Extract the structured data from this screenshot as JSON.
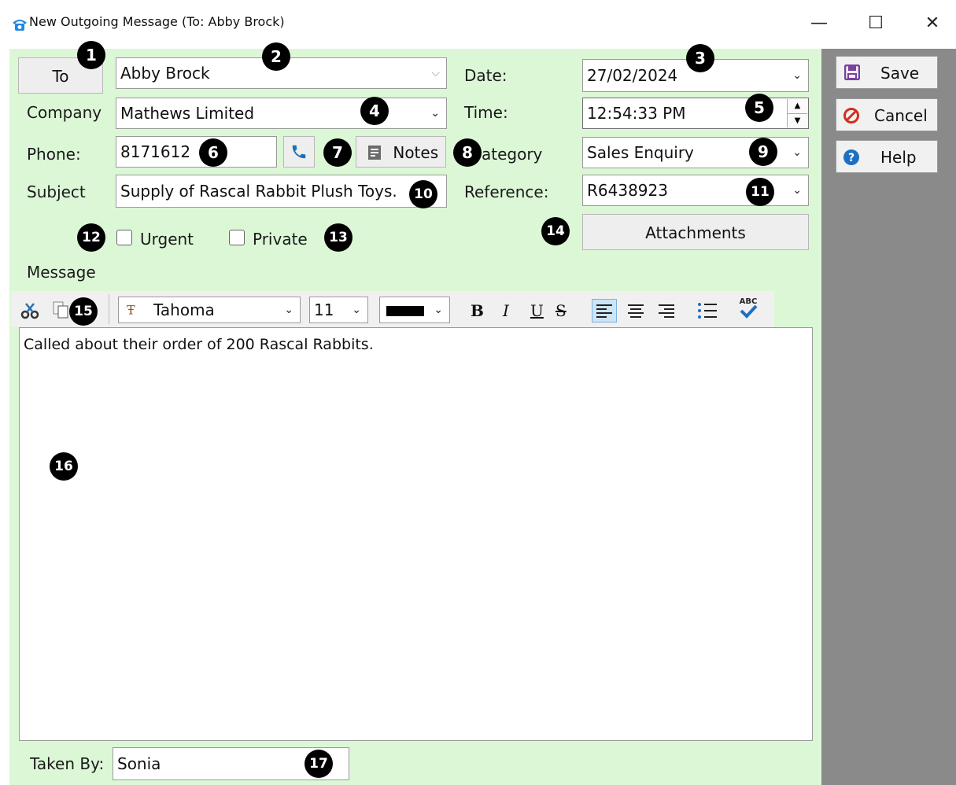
{
  "window": {
    "title": "New Outgoing Message (To: Abby Brock)",
    "minimize_glyph": "—",
    "maximize_glyph": "☐",
    "close_glyph": "✕"
  },
  "to_button": "To",
  "recipient": "Abby Brock",
  "company_label": "Company",
  "company": "Mathews Limited",
  "phone_label": "Phone:",
  "phone": "8171612",
  "notes_button": "Notes",
  "subject_label": "Subject",
  "subject": "Supply of Rascal Rabbit Plush Toys.",
  "date_label": "Date:",
  "date": "27/02/2024",
  "time_label": "Time:",
  "time": "12:54:33 PM",
  "category_label": "ategory",
  "category": "Sales Enquiry",
  "reference_label": "Reference:",
  "reference": "R6438923",
  "attachments_button": "Attachments",
  "urgent_label": "Urgent",
  "private_label": "Private",
  "urgent_checked": false,
  "private_checked": false,
  "message_label": "Message",
  "toolbar": {
    "font_name": "Tahoma",
    "font_size": "11",
    "font_color": "#000000",
    "bold": "B",
    "italic": "I",
    "underline": "U",
    "strike": "S",
    "spell": "ABC"
  },
  "message_text": "Called about their order of 200 Rascal Rabbits.",
  "taken_by_label": "Taken By:",
  "taken_by": "Sonia",
  "side_buttons": {
    "save": "Save",
    "cancel": "Cancel",
    "help": "Help"
  },
  "badges": [
    "1",
    "2",
    "3",
    "4",
    "5",
    "6",
    "7",
    "8",
    "9",
    "10",
    "11",
    "12",
    "13",
    "14",
    "15",
    "16",
    "17"
  ],
  "colors": {
    "form_bg": "#dcf7d6",
    "side_bg": "#8a8a8a",
    "cancel_icon": "#d0301e",
    "help_icon": "#1f6fc0",
    "save_icon": "#7a3fa0",
    "phone_icon": "#1c6fb8"
  }
}
